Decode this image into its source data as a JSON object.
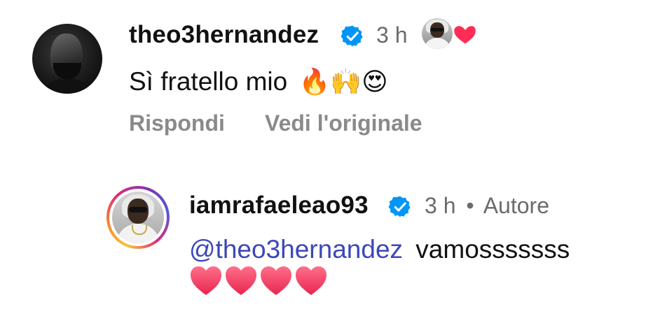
{
  "comments": [
    {
      "username": "theo3hernandez",
      "time": "3 h",
      "text": "Sì fratello mio",
      "emojis": [
        "🔥",
        "🙌",
        "😍"
      ],
      "actions": {
        "reply_label": "Rispondi",
        "see_original_label": "Vedi l'originale"
      }
    },
    {
      "username": "iamrafaeleao93",
      "time": "3 h",
      "separator": "•",
      "author_label": "Autore",
      "mention": "@theo3hernandez",
      "text": "vamosssssss",
      "hearts": [
        "❤️",
        "❤️",
        "❤️",
        "❤️"
      ]
    }
  ],
  "colors": {
    "verified_blue": "#0095f6",
    "mention_blue": "#3d47b8",
    "heart_red": "#ff2d55",
    "muted_gray": "#8a8a8a"
  },
  "icons": {
    "verified": "verified-badge-icon",
    "liked_by_author": "heart-icon"
  }
}
